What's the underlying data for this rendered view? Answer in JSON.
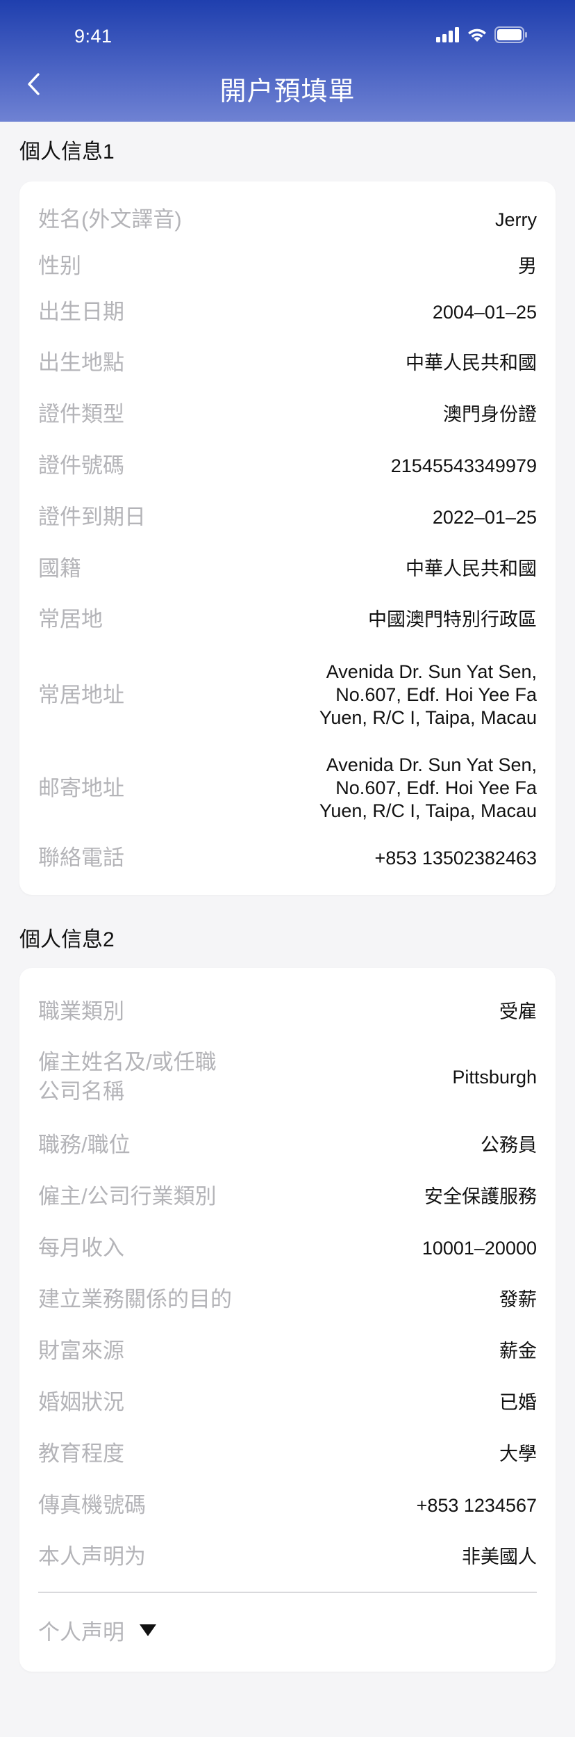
{
  "status_bar": {
    "time": "9:41",
    "icons": [
      "signal-icon",
      "wifi-icon",
      "battery-icon"
    ]
  },
  "nav": {
    "title": "開户預填單",
    "back_icon": "chevron-left-icon"
  },
  "section1": {
    "title": "個人信息1",
    "rows": [
      {
        "label": "姓名(外文譯音)",
        "value": "Jerry"
      },
      {
        "label": "性别",
        "value": "男"
      },
      {
        "label": "出生日期",
        "value": "2004–01–25"
      },
      {
        "label": "出生地點",
        "value": "中華人民共和國"
      },
      {
        "label": "證件類型",
        "value": "澳門身份證"
      },
      {
        "label": "證件號碼",
        "value": "21545543349979"
      },
      {
        "label": "證件到期日",
        "value": "2022–01–25"
      },
      {
        "label": "國籍",
        "value": "中華人民共和國"
      },
      {
        "label": "常居地",
        "value": "中國澳門特別行政區"
      },
      {
        "label": "常居地址",
        "value_lines": [
          "Avenida Dr. Sun Yat Sen,",
          "No.607, Edf. Hoi Yee Fa",
          "Yuen, R/C I, Taipa, Macau"
        ]
      },
      {
        "label": "邮寄地址",
        "value_lines": [
          "Avenida Dr. Sun Yat Sen,",
          "No.607, Edf. Hoi Yee Fa",
          "Yuen, R/C I, Taipa, Macau"
        ]
      },
      {
        "label": "聯絡電話",
        "value": "+853 13502382463"
      }
    ]
  },
  "section2": {
    "title": "個人信息2",
    "rows": [
      {
        "label": "職業類別",
        "value": "受雇"
      },
      {
        "label_lines": [
          "僱主姓名及/或任職",
          "公司名稱"
        ],
        "value": "Pittsburgh"
      },
      {
        "label": "職務/職位",
        "value": "公務員"
      },
      {
        "label": "僱主/公司行業類別",
        "value": "安全保護服務"
      },
      {
        "label": "每月收入",
        "value": "10001–20000"
      },
      {
        "label": "建立業務關係的目的",
        "value": "發薪"
      },
      {
        "label": "財富來源",
        "value": "薪金"
      },
      {
        "label": "婚姻狀況",
        "value": "已婚"
      },
      {
        "label": "教育程度",
        "value": "大學"
      },
      {
        "label": "傳真機號碼",
        "value": "+853 1234567"
      },
      {
        "label": "本人声明为",
        "value": "非美國人"
      }
    ],
    "declaration": {
      "label": "个人声明",
      "icon": "triangle-down-icon"
    }
  },
  "colors": {
    "header_top": "#1f3fae",
    "header_bottom": "#6f82d3",
    "label": "#b4b4b8",
    "value": "#111111",
    "background": "#f5f5f7"
  }
}
